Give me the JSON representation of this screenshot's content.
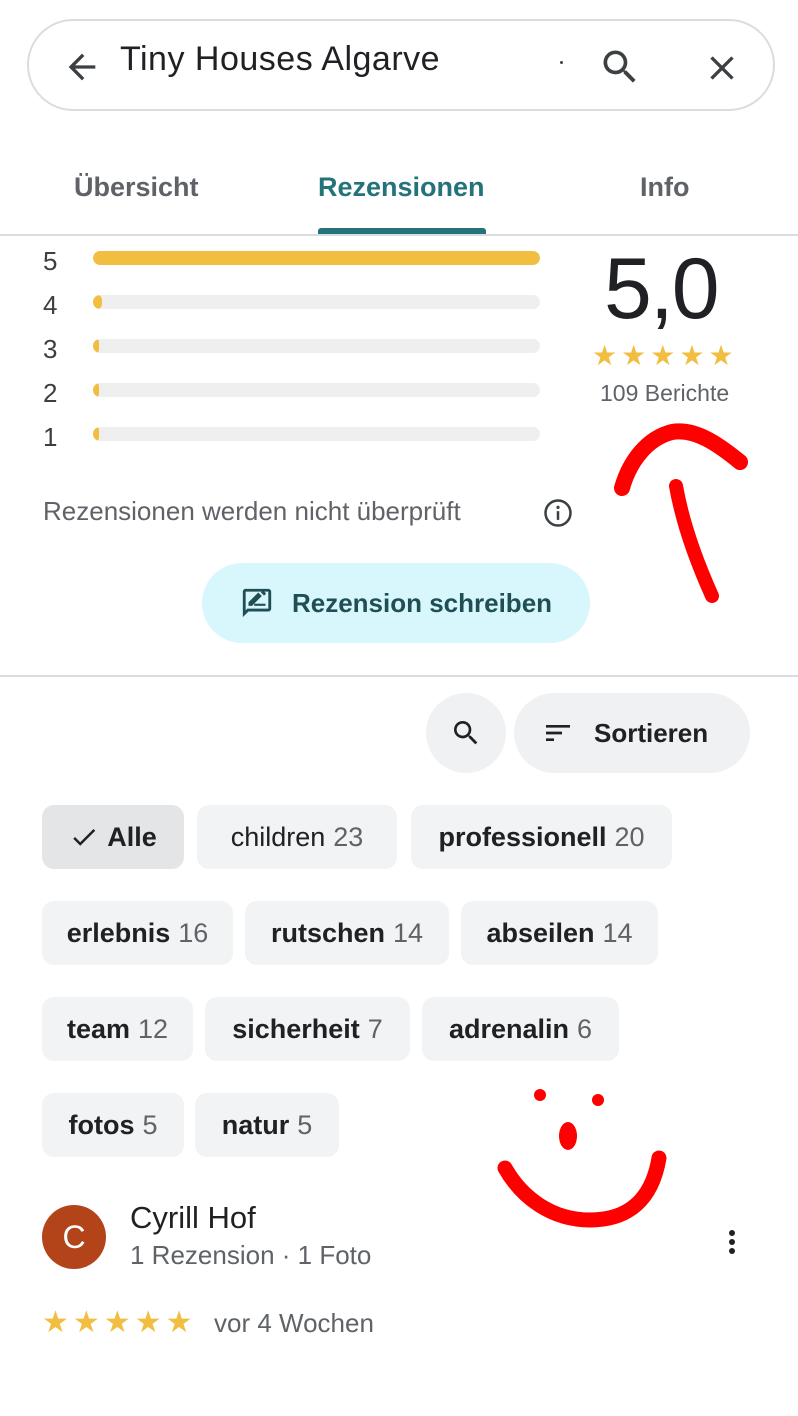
{
  "search": {
    "query": "Tiny Houses Algarve"
  },
  "tabs": [
    {
      "label": "Übersicht",
      "active": false
    },
    {
      "label": "Rezensionen",
      "active": true
    },
    {
      "label": "Info",
      "active": false
    }
  ],
  "ratings": {
    "distribution": [
      {
        "stars": "5",
        "fraction": 1.0
      },
      {
        "stars": "4",
        "fraction": 0.02
      },
      {
        "stars": "3",
        "fraction": 0.005
      },
      {
        "stars": "2",
        "fraction": 0.005
      },
      {
        "stars": "1",
        "fraction": 0.005
      }
    ],
    "average": "5,0",
    "average_stars": 5,
    "count_label": "109 Berichte",
    "disclaimer": "Rezensionen werden nicht überprüft",
    "write_review_label": "Rezension schreiben"
  },
  "toolbar": {
    "sort_label": "Sortieren"
  },
  "chips": [
    {
      "label": "Alle",
      "count": "",
      "selected": true
    },
    {
      "label": "children",
      "count": "23",
      "selected": false
    },
    {
      "label": "professionell",
      "count": "20",
      "selected": false
    },
    {
      "label": "erlebnis",
      "count": "16",
      "selected": false
    },
    {
      "label": "rutschen",
      "count": "14",
      "selected": false
    },
    {
      "label": "abseilen",
      "count": "14",
      "selected": false
    },
    {
      "label": "team",
      "count": "12",
      "selected": false
    },
    {
      "label": "sicherheit",
      "count": "7",
      "selected": false
    },
    {
      "label": "adrenalin",
      "count": "6",
      "selected": false
    },
    {
      "label": "fotos",
      "count": "5",
      "selected": false
    },
    {
      "label": "natur",
      "count": "5",
      "selected": false
    }
  ],
  "review": {
    "avatar_letter": "C",
    "author": "Cyrill Hof",
    "meta": "1 Rezension · 1 Foto",
    "stars": 5,
    "when": "vor 4 Wochen"
  },
  "colors": {
    "accent": "#24737a",
    "star": "#f1be42",
    "avatar": "#b3441a",
    "button_bg": "#d7f7fc",
    "annotation": "#ff0000"
  }
}
